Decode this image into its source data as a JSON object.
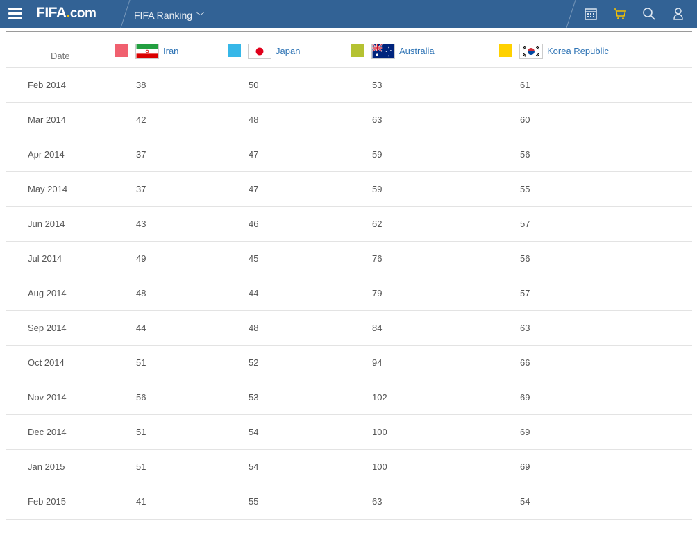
{
  "app": {
    "logo_main": "FIFA",
    "logo_dot": ".",
    "logo_suffix": "com",
    "section_title": "FIFA Ranking",
    "colors": {
      "topbar": "#326295",
      "link": "#2f74b5",
      "cart": "#f6c200"
    },
    "icons": [
      "menu-icon",
      "calendar-icon",
      "cart-icon",
      "search-icon",
      "user-icon"
    ]
  },
  "table": {
    "date_header": "Date",
    "columns": [
      {
        "name": "Iran",
        "swatch_color": "#f0606f",
        "flag": "iran-flag"
      },
      {
        "name": "Japan",
        "swatch_color": "#36b7e8",
        "flag": "japan-flag"
      },
      {
        "name": "Australia",
        "swatch_color": "#b5c232",
        "flag": "australia-flag"
      },
      {
        "name": "Korea Republic",
        "swatch_color": "#ffd100",
        "flag": "korea-republic-flag"
      }
    ],
    "rows": [
      {
        "date": "Feb 2014",
        "values": [
          "38",
          "50",
          "53",
          "61"
        ]
      },
      {
        "date": "Mar 2014",
        "values": [
          "42",
          "48",
          "63",
          "60"
        ]
      },
      {
        "date": "Apr 2014",
        "values": [
          "37",
          "47",
          "59",
          "56"
        ]
      },
      {
        "date": "May 2014",
        "values": [
          "37",
          "47",
          "59",
          "55"
        ]
      },
      {
        "date": "Jun 2014",
        "values": [
          "43",
          "46",
          "62",
          "57"
        ]
      },
      {
        "date": "Jul 2014",
        "values": [
          "49",
          "45",
          "76",
          "56"
        ]
      },
      {
        "date": "Aug 2014",
        "values": [
          "48",
          "44",
          "79",
          "57"
        ]
      },
      {
        "date": "Sep 2014",
        "values": [
          "44",
          "48",
          "84",
          "63"
        ]
      },
      {
        "date": "Oct 2014",
        "values": [
          "51",
          "52",
          "94",
          "66"
        ]
      },
      {
        "date": "Nov 2014",
        "values": [
          "56",
          "53",
          "102",
          "69"
        ]
      },
      {
        "date": "Dec 2014",
        "values": [
          "51",
          "54",
          "100",
          "69"
        ]
      },
      {
        "date": "Jan 2015",
        "values": [
          "51",
          "54",
          "100",
          "69"
        ]
      },
      {
        "date": "Feb 2015",
        "values": [
          "41",
          "55",
          "63",
          "54"
        ]
      }
    ]
  }
}
